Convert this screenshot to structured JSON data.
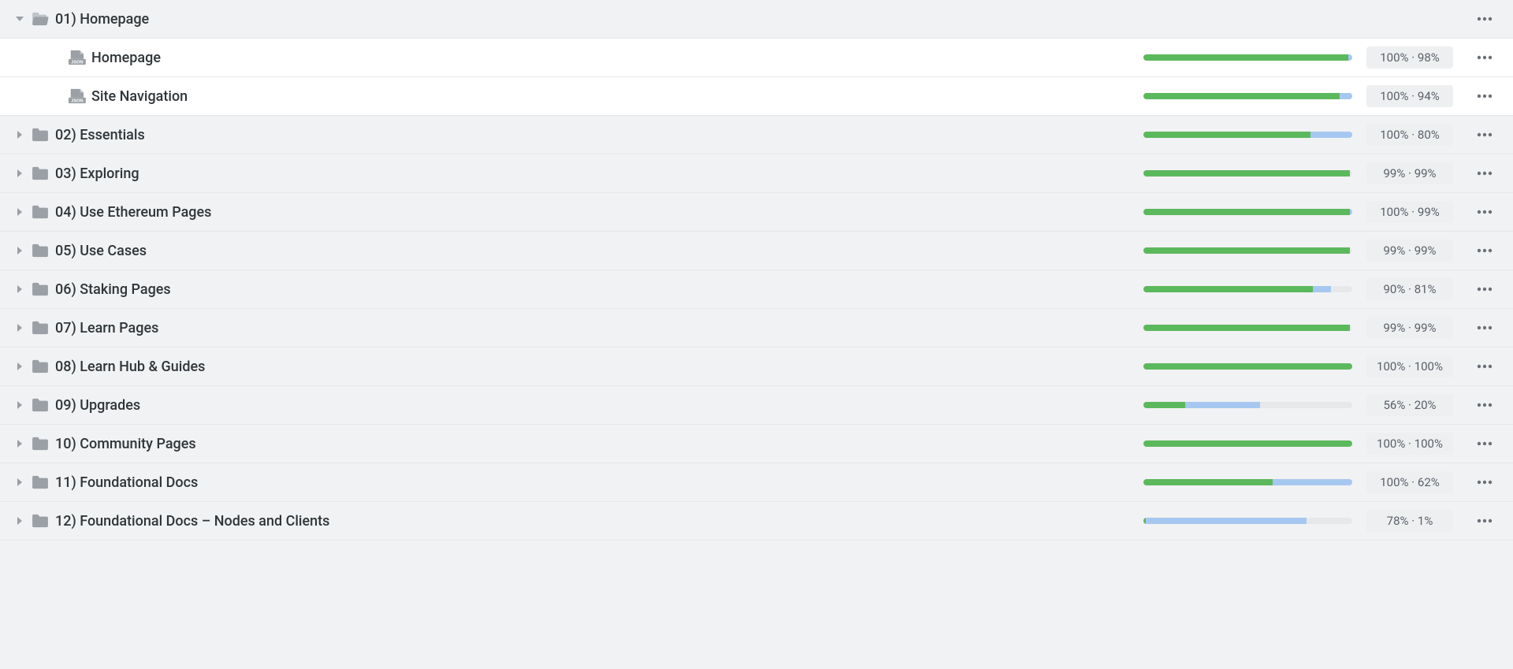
{
  "colors": {
    "progress_green": "#5cb85c",
    "progress_blue": "#a6c8f0",
    "progress_bg": "#e6e8ea",
    "folder": "#9aa0a6"
  },
  "stats_separator": " · ",
  "rows": [
    {
      "kind": "folder",
      "label": "01) Homepage",
      "expanded": true,
      "depth": 0,
      "green": null,
      "blue": null,
      "stat1": null,
      "stat2": null
    },
    {
      "kind": "file",
      "label": "Homepage",
      "expanded": false,
      "depth": 1,
      "green": 98,
      "blue": 2,
      "stat1": "100%",
      "stat2": "98%"
    },
    {
      "kind": "file",
      "label": "Site Navigation",
      "expanded": false,
      "depth": 1,
      "green": 94,
      "blue": 6,
      "stat1": "100%",
      "stat2": "94%"
    },
    {
      "kind": "folder",
      "label": "02) Essentials",
      "expanded": false,
      "depth": 0,
      "green": 80,
      "blue": 20,
      "stat1": "100%",
      "stat2": "80%"
    },
    {
      "kind": "folder",
      "label": "03) Exploring",
      "expanded": false,
      "depth": 0,
      "green": 99,
      "blue": 0,
      "stat1": "99%",
      "stat2": "99%"
    },
    {
      "kind": "folder",
      "label": "04) Use Ethereum Pages",
      "expanded": false,
      "depth": 0,
      "green": 99,
      "blue": 1,
      "stat1": "100%",
      "stat2": "99%"
    },
    {
      "kind": "folder",
      "label": "05) Use Cases",
      "expanded": false,
      "depth": 0,
      "green": 99,
      "blue": 0,
      "stat1": "99%",
      "stat2": "99%"
    },
    {
      "kind": "folder",
      "label": "06) Staking Pages",
      "expanded": false,
      "depth": 0,
      "green": 81,
      "blue": 9,
      "stat1": "90%",
      "stat2": "81%"
    },
    {
      "kind": "folder",
      "label": "07) Learn Pages",
      "expanded": false,
      "depth": 0,
      "green": 99,
      "blue": 0,
      "stat1": "99%",
      "stat2": "99%"
    },
    {
      "kind": "folder",
      "label": "08) Learn Hub & Guides",
      "expanded": false,
      "depth": 0,
      "green": 100,
      "blue": 0,
      "stat1": "100%",
      "stat2": "100%"
    },
    {
      "kind": "folder",
      "label": "09) Upgrades",
      "expanded": false,
      "depth": 0,
      "green": 20,
      "blue": 36,
      "stat1": "56%",
      "stat2": "20%"
    },
    {
      "kind": "folder",
      "label": "10) Community Pages",
      "expanded": false,
      "depth": 0,
      "green": 100,
      "blue": 0,
      "stat1": "100%",
      "stat2": "100%"
    },
    {
      "kind": "folder",
      "label": "11) Foundational Docs",
      "expanded": false,
      "depth": 0,
      "green": 62,
      "blue": 38,
      "stat1": "100%",
      "stat2": "62%"
    },
    {
      "kind": "folder",
      "label": "12) Foundational Docs – Nodes and Clients",
      "expanded": false,
      "depth": 0,
      "green": 1,
      "blue": 77,
      "stat1": "78%",
      "stat2": "1%"
    }
  ]
}
